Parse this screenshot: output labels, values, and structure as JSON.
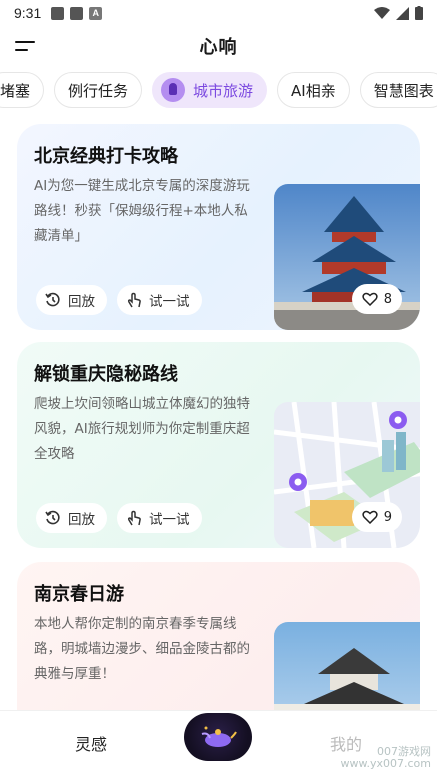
{
  "status_bar": {
    "time": "9:31"
  },
  "header": {
    "title": "心响"
  },
  "tabs": [
    {
      "label": "堵塞"
    },
    {
      "label": "例行任务"
    },
    {
      "label": "城市旅游",
      "active": true
    },
    {
      "label": "AI相亲"
    },
    {
      "label": "智慧图表"
    }
  ],
  "cards": [
    {
      "title": "北京经典打卡攻略",
      "description": "AI为您一键生成北京专属的深度游玩路线！秒获「保姆级行程+本地人私藏清单」",
      "replay_label": "回放",
      "try_label": "试一试",
      "likes": "8",
      "image": "temple-of-heaven"
    },
    {
      "title": "解锁重庆隐秘路线",
      "description": "爬坡上坎间领略山城立体魔幻的独特风貌，AI旅行规划师为你定制重庆超全攻略",
      "replay_label": "回放",
      "try_label": "试一试",
      "likes": "9",
      "image": "city-map"
    },
    {
      "title": "南京春日游",
      "description": "本地人帮你定制的南京春季专属线路，明城墙边漫步、细品金陵古都的典雅与厚重！",
      "image": "nanjing-pavilion"
    }
  ],
  "bottom_nav": {
    "left_label": "灵感",
    "right_label": "我的"
  },
  "watermark": {
    "line1": "007游戏网",
    "line2": "www.yx007.com"
  },
  "colors": {
    "accent": "#7c4ae0",
    "tab_active_bg": "#efe6fb"
  }
}
